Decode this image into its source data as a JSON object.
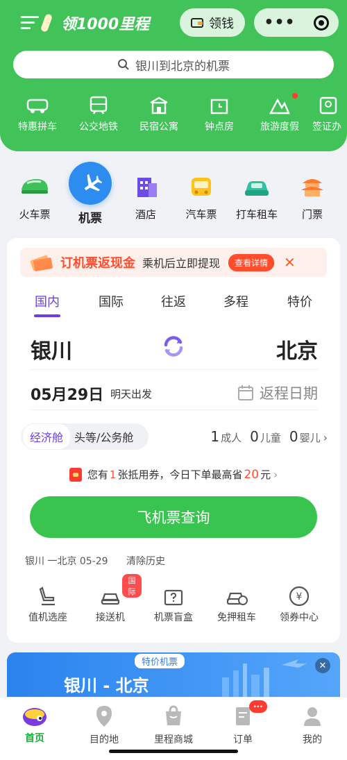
{
  "header": {
    "logo_text": "领1000里程",
    "money_button": "领钱",
    "search_placeholder": "银川到北京的机票",
    "top_categories": [
      "特惠拼车",
      "公交地铁",
      "民宿公寓",
      "钟点房",
      "旅游度假",
      "签证办"
    ]
  },
  "main_categories": [
    "火车票",
    "机票",
    "酒店",
    "汽车票",
    "打车租车",
    "门票"
  ],
  "banner": {
    "title": "订机票返现金",
    "subtitle": "乘机后立即提现",
    "button": "查看详情"
  },
  "tabs": [
    "国内",
    "国际",
    "往返",
    "多程",
    "特价"
  ],
  "search_form": {
    "from": "银川",
    "to": "北京",
    "date": "05月29日",
    "date_note": "明天出发",
    "return_date": "返程日期",
    "cabin_economy": "经济舱",
    "cabin_business": "头等/公务舱",
    "adults": "1",
    "adults_label": "成人",
    "children": "0",
    "children_label": "儿童",
    "infants": "0",
    "infants_label": "婴儿"
  },
  "coupon": {
    "prefix": "您有",
    "count": "1",
    "mid": "张抵用券，今日下单最高省",
    "amount": "20",
    "suffix": "元"
  },
  "search_button": "飞机票查询",
  "history": {
    "route": "银川 一北京 05-29",
    "clear": "清除历史"
  },
  "tools": {
    "items": [
      "值机选座",
      "接送机",
      "机票盲盒",
      "免押租车",
      "领券中心"
    ],
    "badge": "国际"
  },
  "promo": {
    "tag": "特价机票",
    "route": "银川 - 北京"
  },
  "bottom_nav": {
    "items": [
      "首页",
      "目的地",
      "里程商城",
      "订单",
      "我的"
    ],
    "badge": "···"
  },
  "colors": {
    "brand_green": "#41c35a",
    "tab_active": "#6a3de8",
    "coupon_red": "#ff4d2d",
    "accent_orange": "#ff5a2a"
  }
}
